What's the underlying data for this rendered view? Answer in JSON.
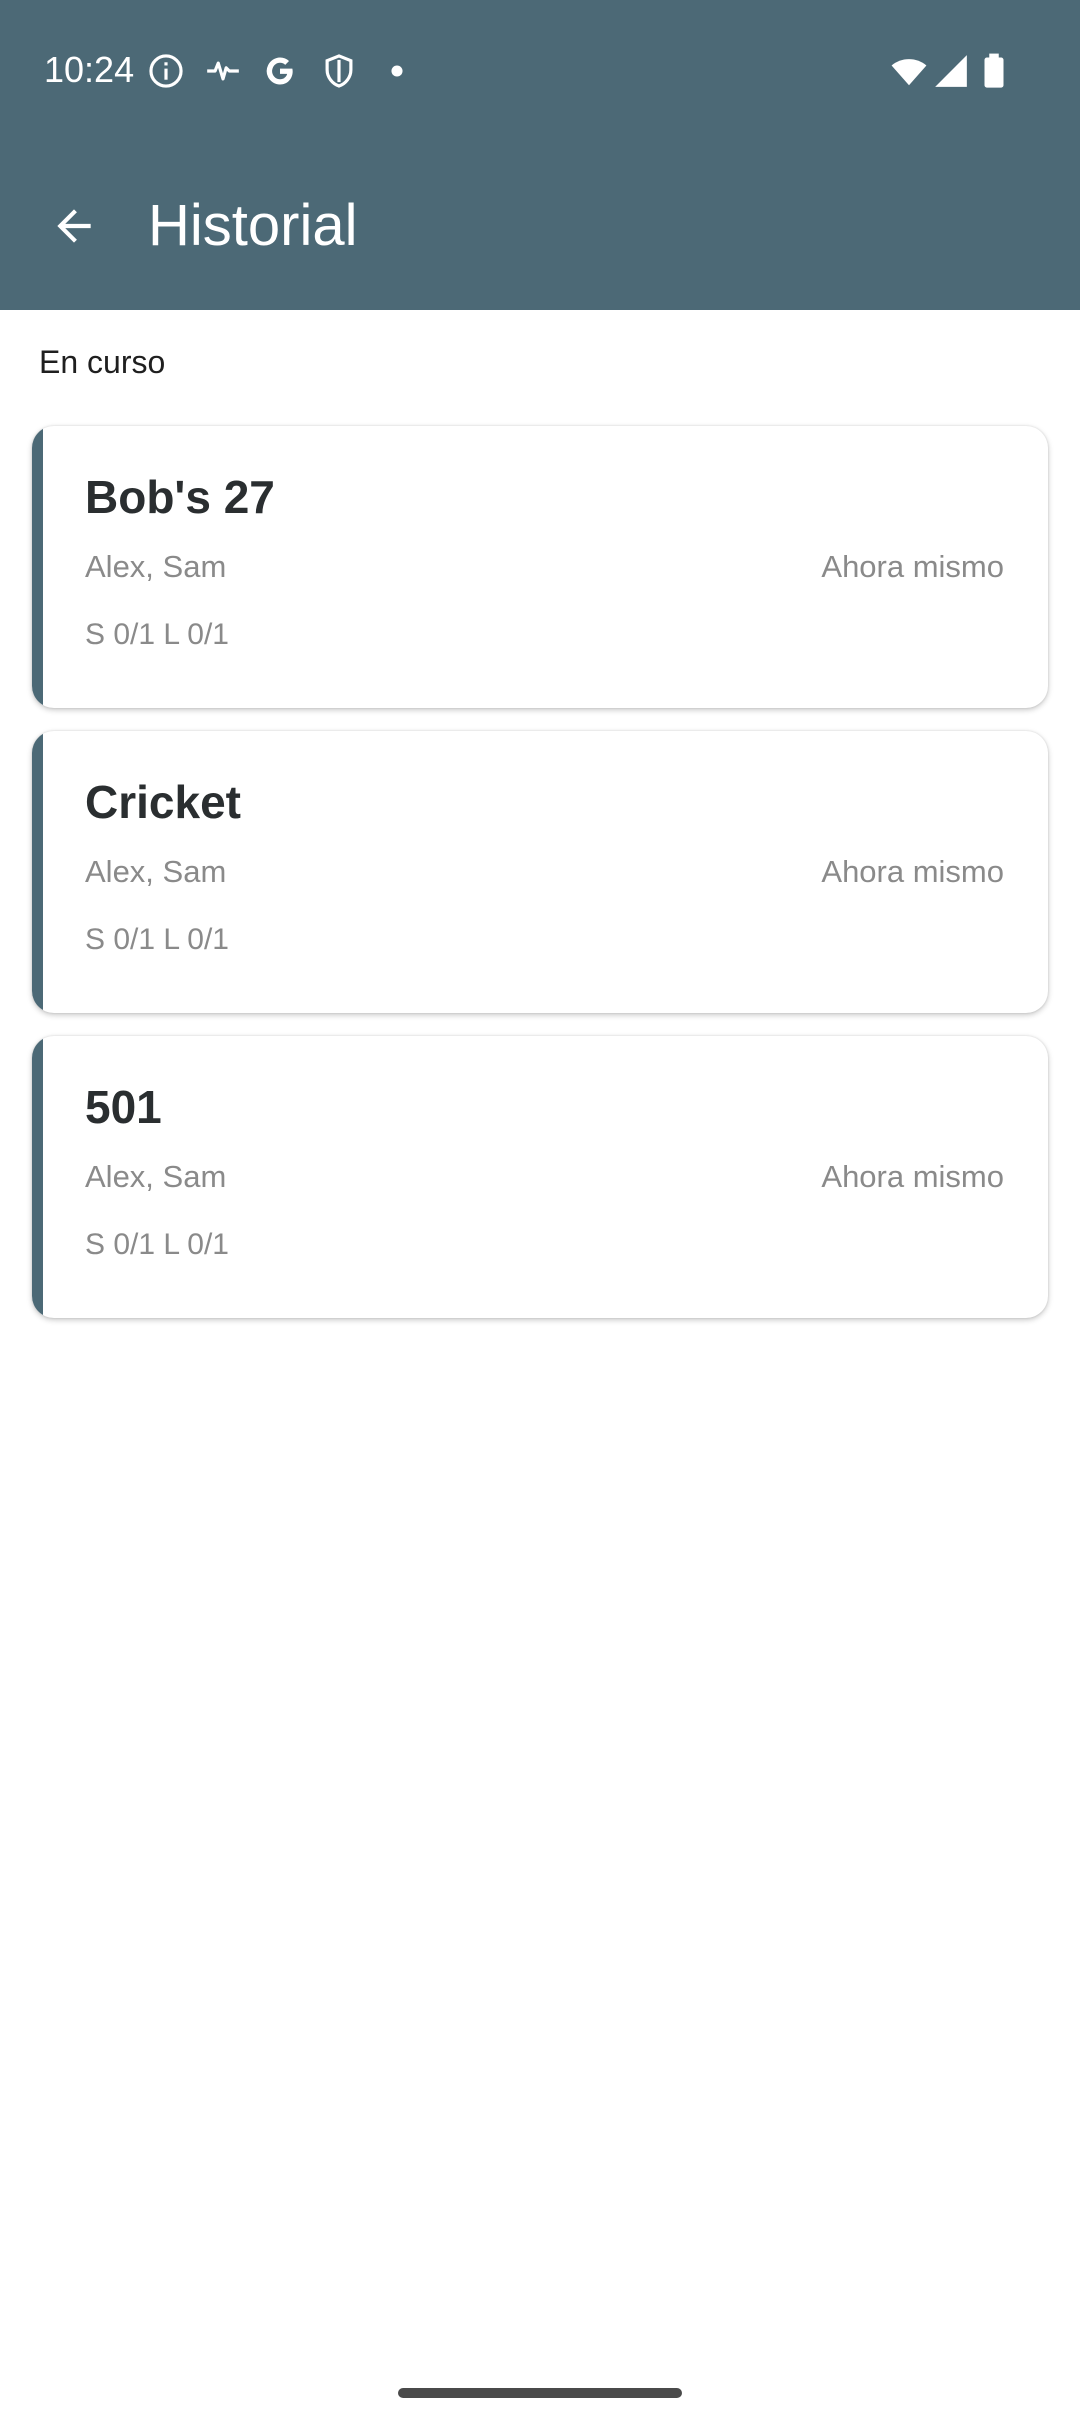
{
  "status_bar": {
    "time": "10:24",
    "icons_left": [
      "info-icon",
      "activity-pulse-icon",
      "google-g-icon",
      "shield-icon",
      "dot-icon"
    ],
    "icons_right": [
      "wifi-icon",
      "cellular-signal-icon",
      "battery-icon"
    ]
  },
  "toolbar": {
    "back_icon": "arrow-back-icon",
    "title": "Historial"
  },
  "section": {
    "title": "En curso"
  },
  "games": [
    {
      "title": "Bob's 27",
      "players": "Alex, Sam",
      "time": "Ahora mismo",
      "score": "S 0/1 L 0/1"
    },
    {
      "title": "Cricket",
      "players": "Alex, Sam",
      "time": "Ahora mismo",
      "score": "S 0/1 L 0/1"
    },
    {
      "title": "501",
      "players": "Alex, Sam",
      "time": "Ahora mismo",
      "score": "S 0/1 L 0/1"
    }
  ],
  "colors": {
    "primary": "#4c6976",
    "background": "#ffffff",
    "title_text": "#2a2e30",
    "secondary_text": "#8a8a8a"
  }
}
